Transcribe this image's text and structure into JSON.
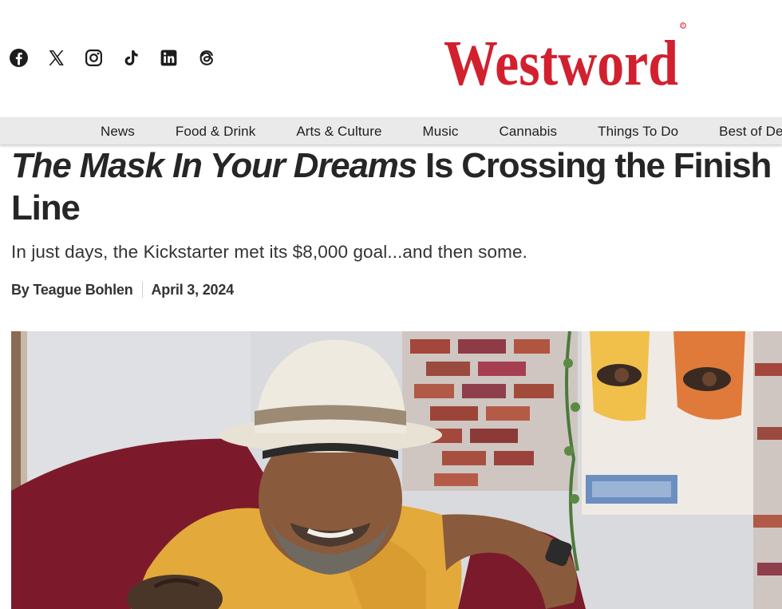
{
  "social": {
    "icons": [
      "facebook-icon",
      "x-icon",
      "instagram-icon",
      "tiktok-icon",
      "linkedin-icon",
      "threads-icon"
    ]
  },
  "logo": {
    "text": "Westword",
    "color": "#d2202f"
  },
  "nav": {
    "items": [
      "News",
      "Food & Drink",
      "Arts & Culture",
      "Music",
      "Cannabis",
      "Things To Do",
      "Best of Denver"
    ]
  },
  "article": {
    "headline_italic": "The Mask In Your Dreams",
    "headline_rest": " Is Crossing the Finish Line",
    "dek": "In just days, the Kickstarter met its $8,000 goal...and then some.",
    "byline_author": "By Teague Bohlen",
    "date": "April 3, 2024"
  },
  "colors": {
    "brand_red": "#d2202f",
    "nav_bg": "#eaeaea",
    "text_dark": "#262626"
  }
}
